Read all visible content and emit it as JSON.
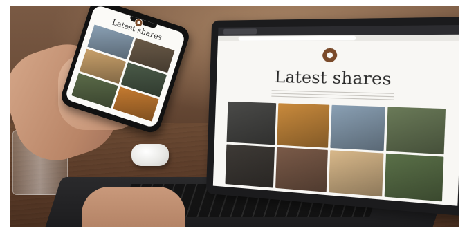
{
  "website": {
    "heading": "Latest shares"
  },
  "phone_app": {
    "heading": "Latest shares"
  },
  "laptop_tiles": [
    {
      "color": "#4a4a48"
    },
    {
      "color": "#c98a3c"
    },
    {
      "color": "#8aa0b4"
    },
    {
      "color": "#6a7a58"
    },
    {
      "color": "#3e3a36"
    },
    {
      "color": "#7a5a48"
    },
    {
      "color": "#d8b88a"
    },
    {
      "color": "#5a7048"
    }
  ],
  "phone_tiles": [
    {
      "color": "#8aa0b4"
    },
    {
      "color": "#6a5a48"
    },
    {
      "color": "#c8a06a"
    },
    {
      "color": "#4a5a48"
    },
    {
      "color": "#5a6a48"
    },
    {
      "color": "#c47a30"
    }
  ]
}
